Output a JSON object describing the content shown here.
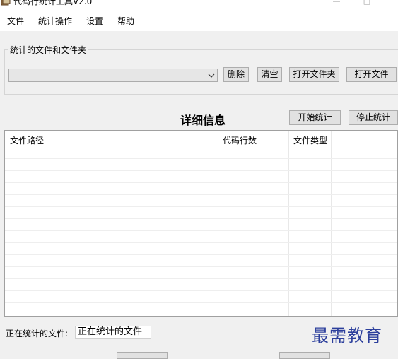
{
  "window": {
    "title": "代码行统计工具V2.0"
  },
  "menu": {
    "items": [
      "文件",
      "统计操作",
      "设置",
      "帮助"
    ]
  },
  "files_group": {
    "label": "统计的文件和文件夹",
    "combo_value": "",
    "buttons": {
      "delete": "删除",
      "clear": "清空",
      "open_folder": "打开文件夹",
      "open_file": "打开文件"
    }
  },
  "details": {
    "title": "详细信息",
    "start_button": "开始统计",
    "stop_button": "停止统计",
    "columns": [
      "文件路径",
      "代码行数",
      "文件类型"
    ]
  },
  "status": {
    "label": "正在统计的文件:",
    "value": "正在统计的文件"
  },
  "watermark": "最需教育"
}
